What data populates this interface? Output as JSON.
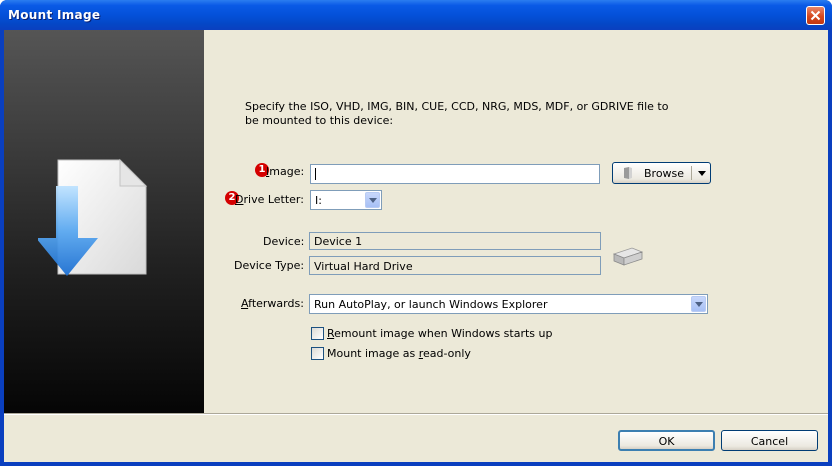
{
  "window": {
    "title": "Mount Image"
  },
  "intro_text": "Specify the ISO, VHD, IMG, BIN, CUE, CCD, NRG, MDS, MDF, or GDRIVE file to be mounted to this device:",
  "image": {
    "badge": "1",
    "label_mnemonic": "I",
    "label_rest": "mage:",
    "value": ""
  },
  "browse": {
    "label": "Browse"
  },
  "drive": {
    "badge": "2",
    "label_mnemonic": "D",
    "label_rest": "rive Letter:",
    "value": "I:"
  },
  "device": {
    "label": "Device:",
    "value": "Device 1"
  },
  "device_type": {
    "label": "Device Type:",
    "value": "Virtual Hard Drive"
  },
  "afterwards": {
    "label_mnemonic": "A",
    "label_rest": "fterwards:",
    "value": "Run AutoPlay, or launch Windows Explorer"
  },
  "options": [
    {
      "mnemonic": "R",
      "rest": "emount image when Windows starts up",
      "checked": false
    },
    {
      "prefix": "Mount image as ",
      "mnemonic": "r",
      "rest": "ead-only",
      "checked": false
    }
  ],
  "buttons": {
    "ok": "OK",
    "cancel": "Cancel"
  },
  "icons": {
    "window_close": "close-icon",
    "side": "document-download-icon",
    "browse": "folder-icon",
    "drive": "hard-drive-icon"
  }
}
